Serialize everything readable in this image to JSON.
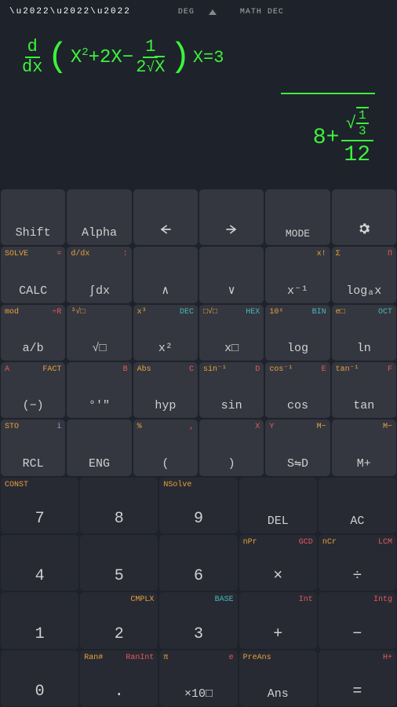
{
  "top": {
    "deg": "DEG",
    "math": "MATH DEC"
  },
  "display": {
    "ddx_num": "d",
    "ddx_den": "dx",
    "term1a": "X",
    "term1exp": "2",
    "plus1": "+2X−",
    "inner_num": "1",
    "inner_den_2": "2",
    "inner_den_x": "X",
    "at": "X=3",
    "res_int": "8+",
    "res_sqrt_num": "1",
    "res_sqrt_den": "3",
    "res_den": "12"
  },
  "r1": {
    "shift": "Shift",
    "alpha": "Alpha",
    "mode": "MODE"
  },
  "r2": {
    "calc_s1": "SOLVE",
    "calc_s2": "=",
    "calc": "CALC",
    "int_s1": "d/dx",
    "int_s2": ":",
    "int": "∫dx",
    "up": "∧",
    "down": "∨",
    "fact_s1": "x!",
    "fact": "x⁻¹",
    "log_s1": "Σ",
    "log_s2": "Π",
    "log": "logₐx"
  },
  "r3": {
    "ab_s1": "mod",
    "ab_s2": "÷R",
    "ab": "a/b",
    "root_s1": "³√□",
    "root": "√□",
    "sq_s1": "x³",
    "sq_s2": "DEC",
    "sq": "x²",
    "pow_s1": "□√□",
    "pow_s2": "HEX",
    "pow": "x□",
    "log_s1": "10ˣ",
    "log_s2": "BIN",
    "log": "log",
    "ln_s1": "e□",
    "ln_s2": "OCT",
    "ln": "ln"
  },
  "r4": {
    "neg_s1": "A",
    "neg_s2": "FACT",
    "neg": "(−)",
    "dms_s1": "B",
    "dms": "°'\"",
    "hyp_s1": "Abs",
    "hyp_s2": "C",
    "hyp": "hyp",
    "sin_s1": "sin⁻¹",
    "sin_s2": "D",
    "sin": "sin",
    "cos_s1": "cos⁻¹",
    "cos_s2": "E",
    "cos": "cos",
    "tan_s1": "tan⁻¹",
    "tan_s2": "F",
    "tan": "tan"
  },
  "r5": {
    "rcl_s1": "STO",
    "rcl_s2": "i",
    "rcl": "RCL",
    "eng": "ENG",
    "lp_s1": "%",
    "lp_s2": ",",
    "lp": "(",
    "rp_s1": "X",
    "rp": ")",
    "sd_s1": "Y",
    "sd_s2": "M−",
    "sd": "S⇋D",
    "mp_s2": "M−",
    "mp": "M+"
  },
  "r6": {
    "k7_s1": "CONST",
    "k7": "7",
    "k8": "8",
    "k9_s1": "NSolve",
    "k9": "9",
    "del": "DEL",
    "ac": "AC"
  },
  "r7": {
    "k4": "4",
    "k5": "5",
    "k6": "6",
    "mul_s1": "nPr",
    "mul_s2": "GCD",
    "mul": "×",
    "div_s1": "nCr",
    "div_s2": "LCM",
    "div": "÷"
  },
  "r8": {
    "k1": "1",
    "k2_s1": "CMPLX",
    "k2": "2",
    "k3_s1": "BASE",
    "k3": "3",
    "add_s1": "Int",
    "add": "+",
    "sub_s1": "Intg",
    "sub": "−"
  },
  "r9": {
    "k0": "0",
    "dot_s1": "Ran#",
    "dot_s2": "RanInt",
    "dot": ".",
    "exp_s1": "π",
    "exp_s2": "e",
    "exp": "×10□",
    "ans_s1": "PreAns",
    "ans": "Ans",
    "eq_s1": "H+",
    "eq": "="
  }
}
